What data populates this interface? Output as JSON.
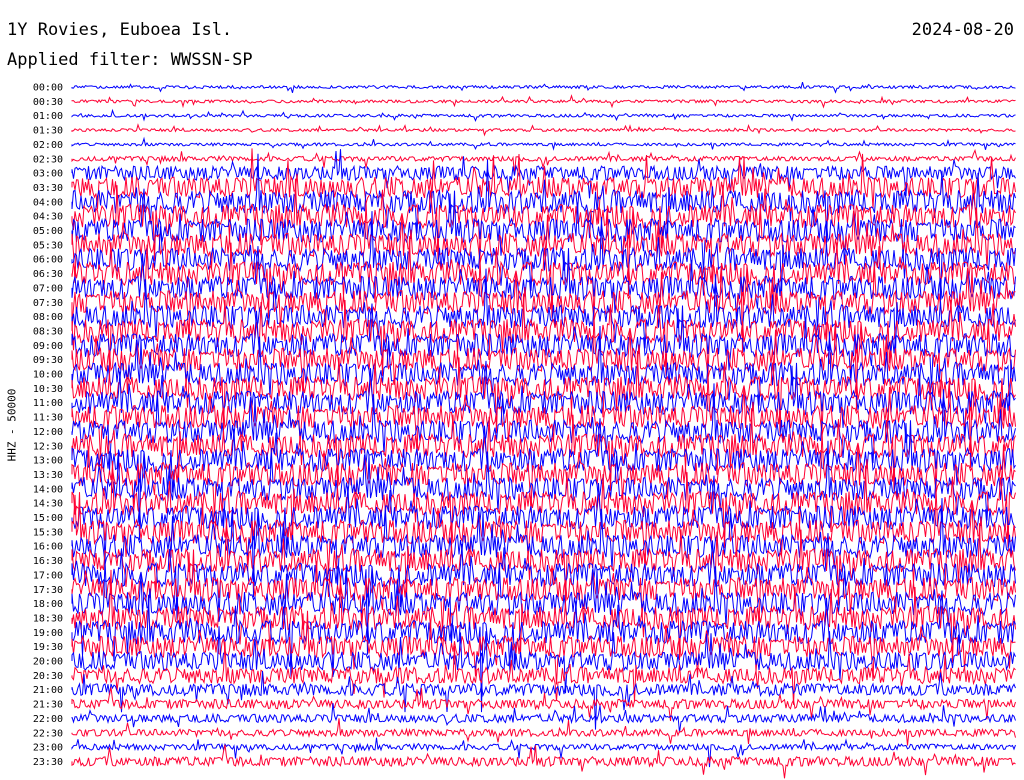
{
  "header": {
    "station": "1Y Rovies, Euboea Isl.",
    "filter": "Applied filter: WWSSN-SP",
    "date": "2024-08-20"
  },
  "colors": {
    "blue": "#0000ff",
    "red": "#ff0033",
    "background": "#ffffff"
  },
  "chart_data": {
    "type": "line",
    "title": "1Y Rovies, Euboea Isl.",
    "ylabel": "HHZ - 50000",
    "xlabel": "",
    "row_labels": [
      "00:00",
      "00:30",
      "01:00",
      "01:30",
      "02:00",
      "02:30",
      "03:00",
      "03:30",
      "04:00",
      "04:30",
      "05:00",
      "05:30",
      "06:00",
      "06:30",
      "07:00",
      "07:30",
      "08:00",
      "08:30",
      "09:00",
      "09:30",
      "10:00",
      "10:30",
      "11:00",
      "11:30",
      "12:00",
      "12:30",
      "13:00",
      "13:30",
      "14:00",
      "14:30",
      "15:00",
      "15:30",
      "16:00",
      "16:30",
      "17:00",
      "17:30",
      "18:00",
      "18:30",
      "19:00",
      "19:30",
      "20:00",
      "20:30",
      "21:00",
      "21:30",
      "22:00",
      "22:30",
      "23:00",
      "23:30"
    ],
    "row_colors": [
      "blue",
      "red"
    ],
    "relative_amplitude": [
      0.12,
      0.12,
      0.12,
      0.12,
      0.12,
      0.2,
      0.6,
      0.9,
      1.0,
      1.0,
      1.0,
      1.0,
      1.0,
      1.0,
      1.0,
      1.0,
      1.0,
      1.0,
      1.0,
      1.0,
      1.0,
      1.0,
      1.0,
      1.0,
      1.0,
      1.0,
      1.0,
      1.0,
      1.0,
      1.0,
      1.0,
      1.0,
      1.0,
      1.0,
      1.0,
      1.0,
      1.0,
      1.0,
      1.0,
      0.9,
      0.8,
      0.7,
      0.5,
      0.4,
      0.35,
      0.3,
      0.25,
      0.4
    ],
    "grid": false,
    "legend": "none"
  }
}
